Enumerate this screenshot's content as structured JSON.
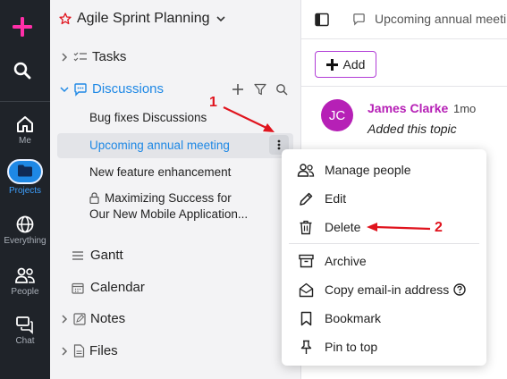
{
  "rail": {
    "items": [
      {
        "label": "Me",
        "icon": "home-icon"
      },
      {
        "label": "Projects",
        "icon": "folder-icon"
      },
      {
        "label": "Everything",
        "icon": "globe-icon"
      },
      {
        "label": "People",
        "icon": "people-icon"
      },
      {
        "label": "Chat",
        "icon": "chat-icon"
      }
    ]
  },
  "project": {
    "title": "Agile Sprint Planning",
    "sections": {
      "tasks": "Tasks",
      "discussions": "Discussions",
      "gantt": "Gantt",
      "calendar": "Calendar",
      "notes": "Notes",
      "files": "Files"
    },
    "discussions": [
      "Bug fixes Discussions",
      "Upcoming annual meeting",
      "New feature enhancement",
      "Maximizing Success for",
      "Our New Mobile Application..."
    ]
  },
  "main": {
    "topbar_title": "Upcoming annual meeting",
    "add_label": "Add",
    "comment": {
      "initials": "JC",
      "author": "James Clarke",
      "time": "1mo",
      "text": "Added this topic"
    }
  },
  "menu": {
    "items": [
      "Manage people",
      "Edit",
      "Delete",
      "Archive",
      "Copy email-in address",
      "Bookmark",
      "Pin to top"
    ]
  },
  "annotations": {
    "step1": "1",
    "step2": "2"
  },
  "colors": {
    "accent_blue": "#1e88e5",
    "brand_magenta": "#b620b6",
    "annotation_red": "#e0141e",
    "rail_bg": "#1f2329"
  }
}
